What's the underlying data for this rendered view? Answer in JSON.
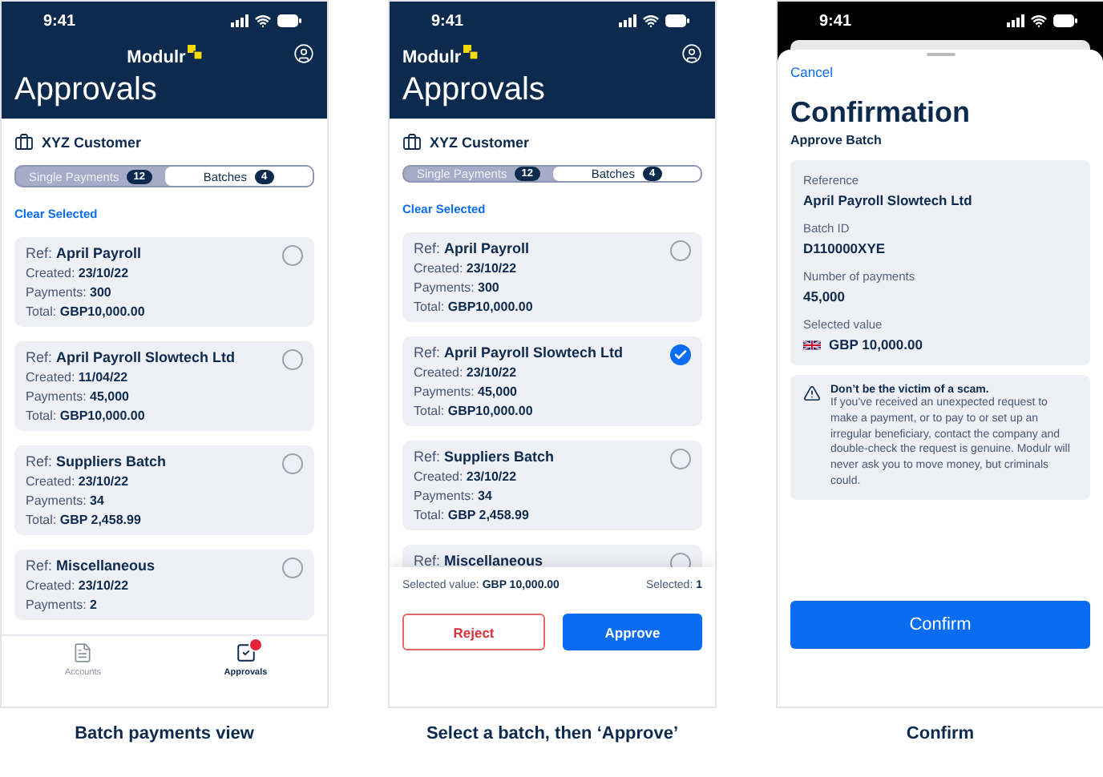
{
  "screens": [
    {
      "kind": "list",
      "status_time": "9:41",
      "brand": "Modulr",
      "title": "Approvals",
      "customer": "XYZ Customer",
      "tabs": [
        {
          "label": "Single Payments",
          "count": "12",
          "selected": false
        },
        {
          "label": "Batches",
          "count": "4",
          "selected": true
        }
      ],
      "clear_link": "Clear Selected",
      "batches": [
        {
          "lines": [
            "Ref: **April Payroll**",
            "Created: **23/10/22**",
            "Payments: **300**",
            "Total: **GBP10,000.00**"
          ],
          "selected": false
        },
        {
          "lines": [
            "Ref: **April Payroll Slowtech Ltd**",
            "Created: **11/04/22**",
            "Payments: **45,000**",
            "Total: **GBP10,000.00**"
          ],
          "selected": false
        },
        {
          "lines": [
            "Ref: **Suppliers Batch**",
            "Created: **23/10/22**",
            "Payments: **34**",
            "Total: **GBP 2,458.99**"
          ],
          "selected": false
        },
        {
          "lines": [
            "Ref: **Miscellaneous**",
            "Created: **23/10/22**",
            "Payments: **2**"
          ],
          "selected": false
        }
      ],
      "nav": [
        {
          "label": "Accounts",
          "selected": false,
          "badge": false
        },
        {
          "label": "Approvals",
          "selected": true,
          "badge": true
        }
      ],
      "caption": "Batch payments view"
    },
    {
      "kind": "select",
      "status_time": "9:41",
      "brand": "Modulr",
      "title": "Approvals",
      "customer": "XYZ Customer",
      "tabs": [
        {
          "label": "Single Payments",
          "count": "12",
          "selected": false
        },
        {
          "label": "Batches",
          "count": "4",
          "selected": true
        }
      ],
      "clear_link": "Clear Selected",
      "batches": [
        {
          "lines": [
            "Ref: **April Payroll**",
            "Created: **23/10/22**",
            "Payments: **300**",
            "Total: **GBP10,000.00**"
          ],
          "selected": false
        },
        {
          "lines": [
            "Ref: **April Payroll Slowtech Ltd**",
            "Created: **23/10/22**",
            "Payments: **45,000**",
            "Total: **GBP10,000.00**"
          ],
          "selected": true
        },
        {
          "lines": [
            "Ref: **Suppliers Batch**",
            "Created: **23/10/22**",
            "Payments: **34**",
            "Total: **GBP 2,458.99**"
          ],
          "selected": false
        },
        {
          "lines": [
            "Ref: **Miscellaneous**"
          ],
          "selected": false
        }
      ],
      "selected_value": "Selected value: **GBP 10,000.00**",
      "selected_count": "Selected: **1**",
      "buttons": [
        {
          "kind": "reject",
          "label": "Reject"
        },
        {
          "kind": "approve",
          "label": "Approve"
        }
      ],
      "caption": "Select a batch, then ‘Approve’"
    },
    {
      "kind": "confirm",
      "status_time": "9:41",
      "cancel": "Cancel",
      "title": "Confirmation",
      "subtitle": "Approve Batch",
      "details": [
        {
          "label": "Reference",
          "value": "April Payroll Slowtech Ltd",
          "flag": false
        },
        {
          "label": "Batch ID",
          "value": "D110000XYE",
          "flag": false
        },
        {
          "label": "Number of payments",
          "value": "45,000",
          "flag": false
        },
        {
          "label": "Selected value",
          "value": "GBP 10,000.00",
          "flag": true
        }
      ],
      "warning": {
        "title": "Don’t be the victim of a scam.",
        "body": "If you’ve received an unexpected request to make a payment, or to pay to or set up an irregular beneficiary, contact the company and double-check the request is genuine. Modulr will never ask you to move money, but criminals could."
      },
      "confirm_button": "Confirm",
      "caption": "Confirm"
    }
  ]
}
